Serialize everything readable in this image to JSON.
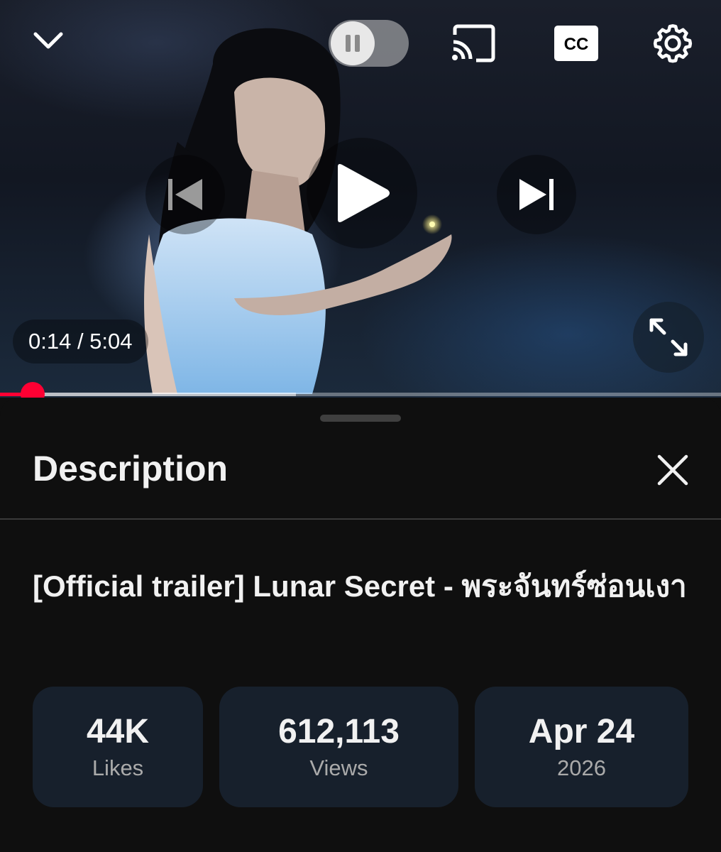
{
  "player": {
    "current_time": "0:14",
    "duration": "5:04",
    "time_display": "0:14 / 5:04",
    "cc_label": "CC",
    "autoplay_on": false,
    "progress": {
      "played_fraction": 0.045,
      "buffered_fraction": 0.41
    },
    "icons": {
      "collapse": "chevron-down-icon",
      "autoplay": "pause-icon",
      "cast": "cast-icon",
      "captions": "cc-icon",
      "settings": "gear-icon",
      "previous": "skip-previous-icon",
      "play": "play-icon",
      "next": "skip-next-icon",
      "fullscreen": "fullscreen-icon"
    }
  },
  "description_panel": {
    "header": "Description",
    "close_icon": "close-icon",
    "video_title": "[Official trailer] Lunar Secret - พระจันทร์ซ่อนเงา",
    "stats": [
      {
        "value": "44K",
        "label": "Likes"
      },
      {
        "value": "612,113",
        "label": "Views"
      },
      {
        "value": "Apr 24",
        "label": "2026"
      }
    ]
  },
  "colors": {
    "progress_red": "#ff0033",
    "sheet_background": "#0f0f0f",
    "stat_card_background": "#17202c",
    "secondary_text": "#aaaaaa"
  }
}
